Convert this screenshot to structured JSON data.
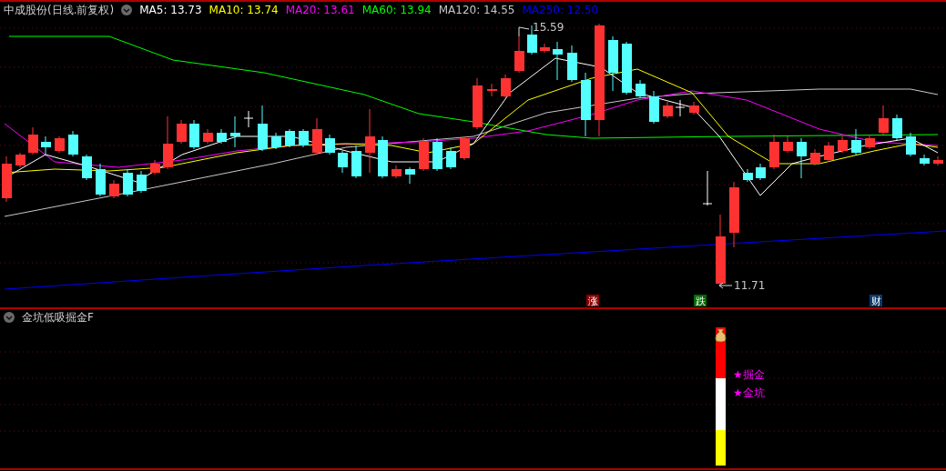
{
  "header": {
    "title": "中成股份(日线.前复权)",
    "indicators": [
      {
        "label": "MA5: 13.73",
        "color": "#ffffff"
      },
      {
        "label": "MA10: 13.74",
        "color": "#ffff00"
      },
      {
        "label": "MA20: 13.61",
        "color": "#ff00ff"
      },
      {
        "label": "MA60: 13.94",
        "color": "#00ff00"
      },
      {
        "label": "MA120: 14.55",
        "color": "#c8c8c8"
      },
      {
        "label": "MA250: 12.50",
        "color": "#0000ff"
      }
    ]
  },
  "price_chart": {
    "high_label": "15.59",
    "low_label": "11.71",
    "markers": [
      {
        "text": "涨",
        "kind": "up"
      },
      {
        "text": "跌",
        "kind": "down"
      },
      {
        "text": "财",
        "kind": "finance"
      }
    ]
  },
  "indicator_panel": {
    "title": "金坑低吸掘金F",
    "signals": [
      {
        "text": "★掘金"
      },
      {
        "text": "★金坑"
      }
    ]
  }
}
